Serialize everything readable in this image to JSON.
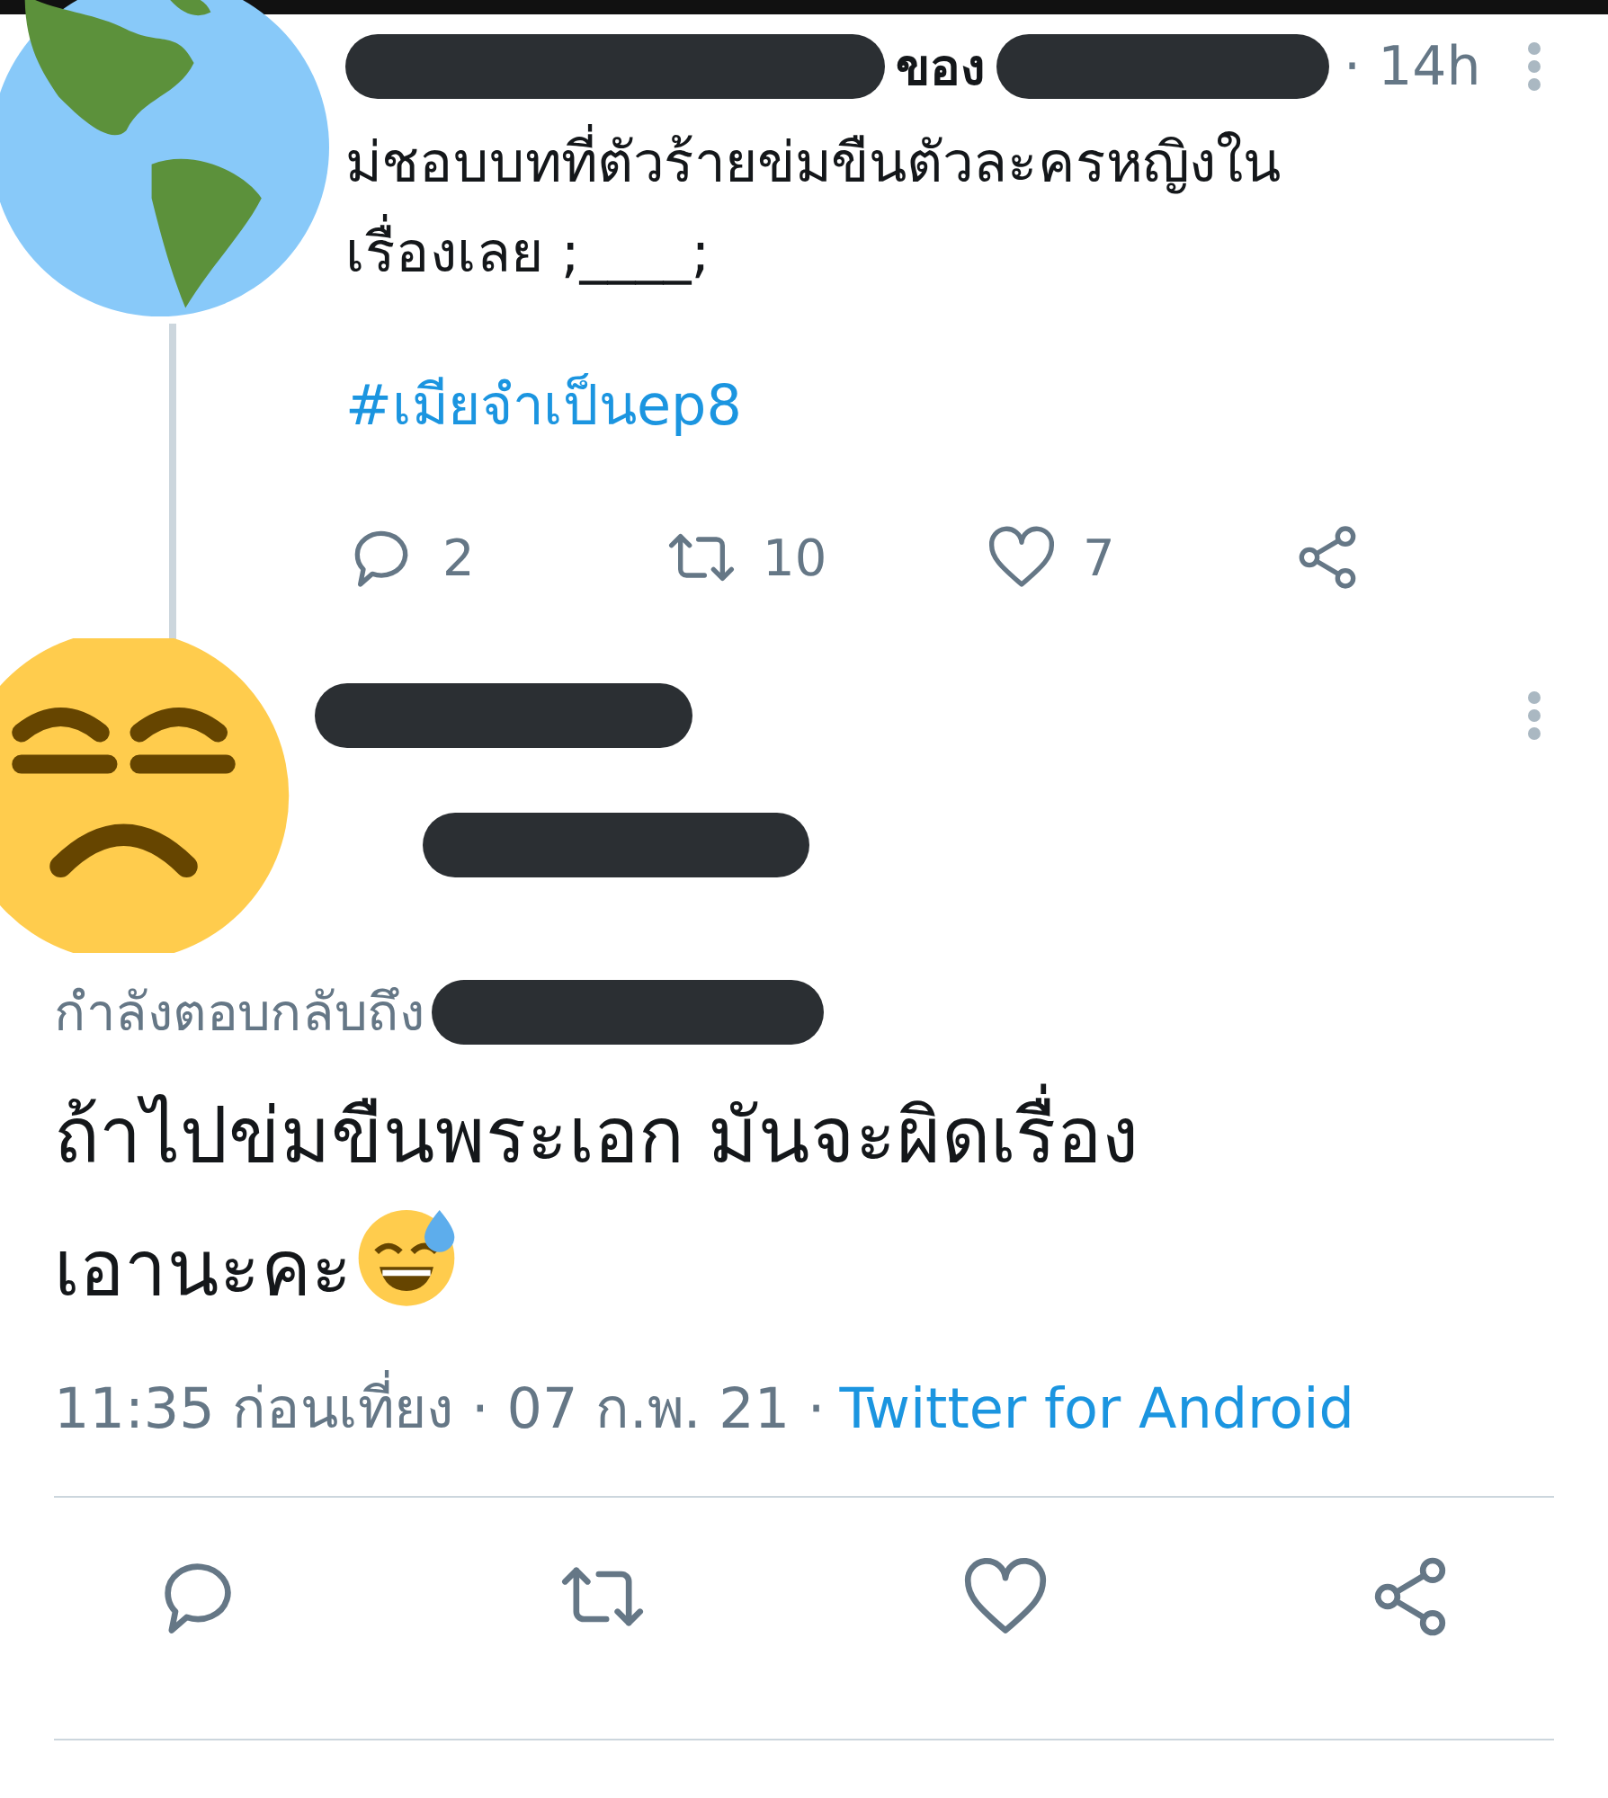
{
  "tweet": {
    "name_fragment": "ของ",
    "time": "· 14h",
    "text": "ม่ชอบบทที่ตัวร้ายข่มขืนตัวละครหญิงใน\nเรื่องเลย ;____;",
    "hashtag": "#เมียจำเป็นep8",
    "actions": [
      {
        "kind": "reply",
        "count": "2"
      },
      {
        "kind": "retweet",
        "count": "10"
      },
      {
        "kind": "like",
        "count": "7"
      },
      {
        "kind": "share"
      }
    ]
  },
  "reply": {
    "replying_to": "กำลังตอบกลับถึง",
    "text": "ถ้าไปข่มขืนพระเอก  มันจะผิดเรื่อง\nเอานะคะ",
    "meta": "11:35 ก่อนเที่ยง · 07 ก.พ. 21 ·",
    "client": "Twitter for Android",
    "actions": [
      {
        "kind": "reply"
      },
      {
        "kind": "retweet"
      },
      {
        "kind": "like"
      },
      {
        "kind": "share"
      }
    ]
  }
}
